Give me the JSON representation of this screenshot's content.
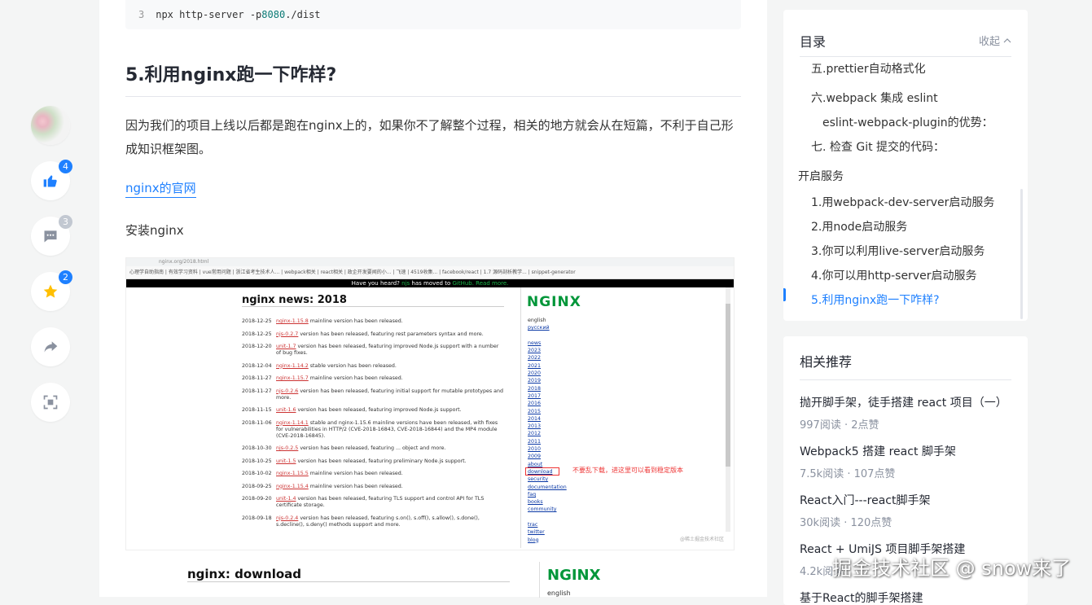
{
  "code": {
    "line_no": "3",
    "cmd": "npx http-server -p ",
    "port": "8080",
    "path": " ./dist"
  },
  "article": {
    "section_title": "5.利用nginx跑一下咋样?",
    "paragraph": "因为我们的项目上线以后都是跑在nginx上的，如果你不了解整个过程，相关的地方就会从在短篇，不利于自己形成知识框架图。",
    "link_text": "nginx的官网",
    "install_text": "安装nginx"
  },
  "actions": {
    "like_count": "4",
    "comment_count": "3",
    "collect_count": "2",
    "colors": {
      "badge_blue": "#1e80ff",
      "badge_gray": "#c2c8d1"
    }
  },
  "screenshot": {
    "url": "nginx.org/2018.html",
    "bookmarks": "心理学自助指南 | 有效学习资料 | vue常用问题 | 浙江省考生技术人... | webpack相关 | react相关 | 政企开发要闻的小... | 飞速 | 4519收集... | facebook/react | 1.7 源码剖析教学... | snippet-generator",
    "notice_a": "Have you heard? ",
    "notice_b": "njs",
    "notice_c": " has moved to ",
    "notice_d": "GitHub",
    "notice_e": ". Read more.",
    "news_title": "nginx news: 2018",
    "news": [
      {
        "date": "2018-12-25",
        "link": "nginx-1.15.8",
        "text": " mainline version has been released."
      },
      {
        "date": "2018-12-25",
        "link": "njs-0.2.7",
        "text": " version has been released, featuring rest parameters syntax and more."
      },
      {
        "date": "2018-12-20",
        "link": "unit-1.7",
        "text": " version has been released, featuring improved Node.js support with a number of bug fixes."
      },
      {
        "date": "2018-12-04",
        "link": "nginx-1.14.2",
        "text": " stable version has been released."
      },
      {
        "date": "2018-11-27",
        "link": "nginx-1.15.7",
        "text": " mainline version has been released."
      },
      {
        "date": "2018-11-27",
        "link": "njs-0.2.6",
        "text": " version has been released, featuring initial support for mutable prototypes and more."
      },
      {
        "date": "2018-11-15",
        "link": "unit-1.6",
        "text": " version has been released, featuring improved Node.js support."
      },
      {
        "date": "2018-11-06",
        "link": "nginx-1.14.1",
        "text": " stable and nginx-1.15.6 mainline versions have been released, with fixes for vulnerabilities in HTTP/2 (CVE-2018-16843, CVE-2018-16844) and the MP4 module (CVE-2018-16845)."
      },
      {
        "date": "2018-10-30",
        "link": "njs-0.2.5",
        "text": " version has been released, featuring ... object and more."
      },
      {
        "date": "2018-10-25",
        "link": "unit-1.5",
        "text": " version has been released, featuring preliminary Node.js support."
      },
      {
        "date": "2018-10-02",
        "link": "nginx-1.15.5",
        "text": " mainline version has been released."
      },
      {
        "date": "2018-09-25",
        "link": "nginx-1.15.4",
        "text": " mainline version has been released."
      },
      {
        "date": "2018-09-20",
        "link": "unit-1.4",
        "text": " version has been released, featuring TLS support and control API for TLS certificate storage."
      },
      {
        "date": "2018-09-18",
        "link": "njs-0.2.4",
        "text": " version has been released, featuring s.on(), s.off(), s.allow(), s.done(), s.decline(), s.deny() methods support and more."
      }
    ],
    "logo": "NGINX",
    "nav": [
      "english",
      "русский",
      "",
      "news",
      "2023",
      "2022",
      "2021",
      "2020",
      "2019",
      "2018",
      "2017",
      "2016",
      "2015",
      "2014",
      "2013",
      "2012",
      "2011",
      "2010",
      "2009",
      "about",
      "download",
      "security",
      "documentation",
      "faq",
      "books",
      "community",
      "",
      "trac",
      "twitter",
      "blog"
    ],
    "annotation": "不要乱下载，进这里可以看到稳定版本",
    "wm": "@稀土掘金技术社区",
    "second_title": "nginx: download",
    "second_logo": "NGINX",
    "second_sub": "english"
  },
  "toc": {
    "title": "目录",
    "collapse": "收起",
    "items": [
      {
        "label": "五.prettier自动格式化",
        "level": 2
      },
      {
        "label": "六.webpack 集成 eslint",
        "level": 2
      },
      {
        "label": "eslint-webpack-plugin的优势：",
        "level": 3
      },
      {
        "label": "七. 检查 Git 提交的代码：",
        "level": 2
      },
      {
        "label": "开启服务",
        "level": 1
      },
      {
        "label": "1.用webpack-dev-server启动服务",
        "level": 2
      },
      {
        "label": "2.用node启动服务",
        "level": 2
      },
      {
        "label": "3.你可以利用live-server启动服务",
        "level": 2
      },
      {
        "label": "4.你可以用http-server启动服务",
        "level": 2
      },
      {
        "label": "5.利用nginx跑一下咋样?",
        "level": 2,
        "active": true
      }
    ]
  },
  "related": {
    "title": "相关推荐",
    "items": [
      {
        "title": "抛开脚手架，徒手搭建 react 项目（一）",
        "meta": "997阅读 · 2点赞"
      },
      {
        "title": "Webpack5 搭建 react 脚手架",
        "meta": "7.5k阅读 · 107点赞"
      },
      {
        "title": "React入门---react脚手架",
        "meta": "30k阅读 · 120点赞"
      },
      {
        "title": "React + UmiJS 项目脚手架搭建",
        "meta": "4.2k阅读"
      },
      {
        "title": "基于React的脚手架搭建",
        "meta": ""
      }
    ]
  },
  "watermark": "掘金技术社区 @ snow来了"
}
